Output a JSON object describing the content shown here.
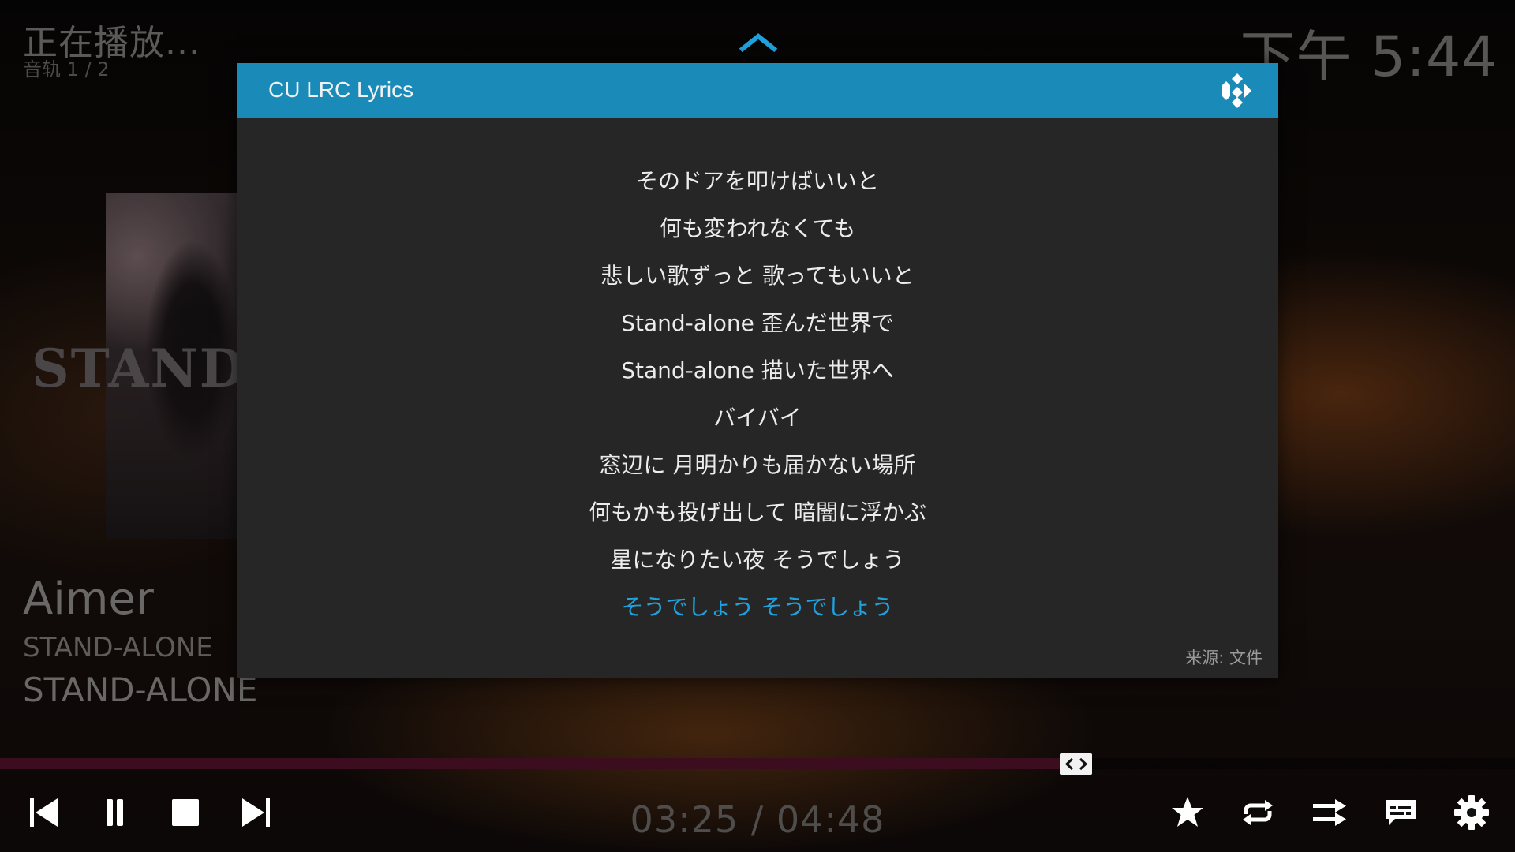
{
  "header": {
    "now_playing": "正在播放...",
    "track_count": "音轨 1 / 2",
    "clock": "下午 5:44"
  },
  "album_art": {
    "overlay_text": "STAND-A"
  },
  "info": {
    "artist": "Aimer",
    "album": "STAND-ALONE",
    "song": "STAND-ALONE"
  },
  "dialog": {
    "title": "CU LRC Lyrics",
    "source": "来源: 文件",
    "lyrics": [
      "そのドアを叩けばいいと",
      "何も変われなくても",
      "悲しい歌ずっと 歌ってもいいと",
      "Stand-alone 歪んだ世界で",
      "Stand-alone 描いた世界へ",
      "バイバイ",
      "窓辺に 月明かりも届かない場所",
      "何もかも投げ出して 暗闇に浮かぶ",
      "星になりたい夜 そうでしょう",
      "そうでしょう そうでしょう"
    ],
    "current_line_index": 9
  },
  "player": {
    "elapsed": "03:25",
    "total": "04:48",
    "separator": " / ",
    "progress_fraction": 0.712
  },
  "colors": {
    "accent": "#1a8ab8",
    "current_lyric": "#1fa3e0",
    "progress_fill": "#3b0d1e"
  },
  "icons": {
    "previous": "skip-previous-icon",
    "pause": "pause-icon",
    "stop": "stop-icon",
    "next": "skip-next-icon",
    "favourite": "star-icon",
    "repeat": "repeat-icon",
    "shuffle": "shuffle-icon",
    "subtitles": "subtitles-icon",
    "settings": "gear-icon"
  }
}
